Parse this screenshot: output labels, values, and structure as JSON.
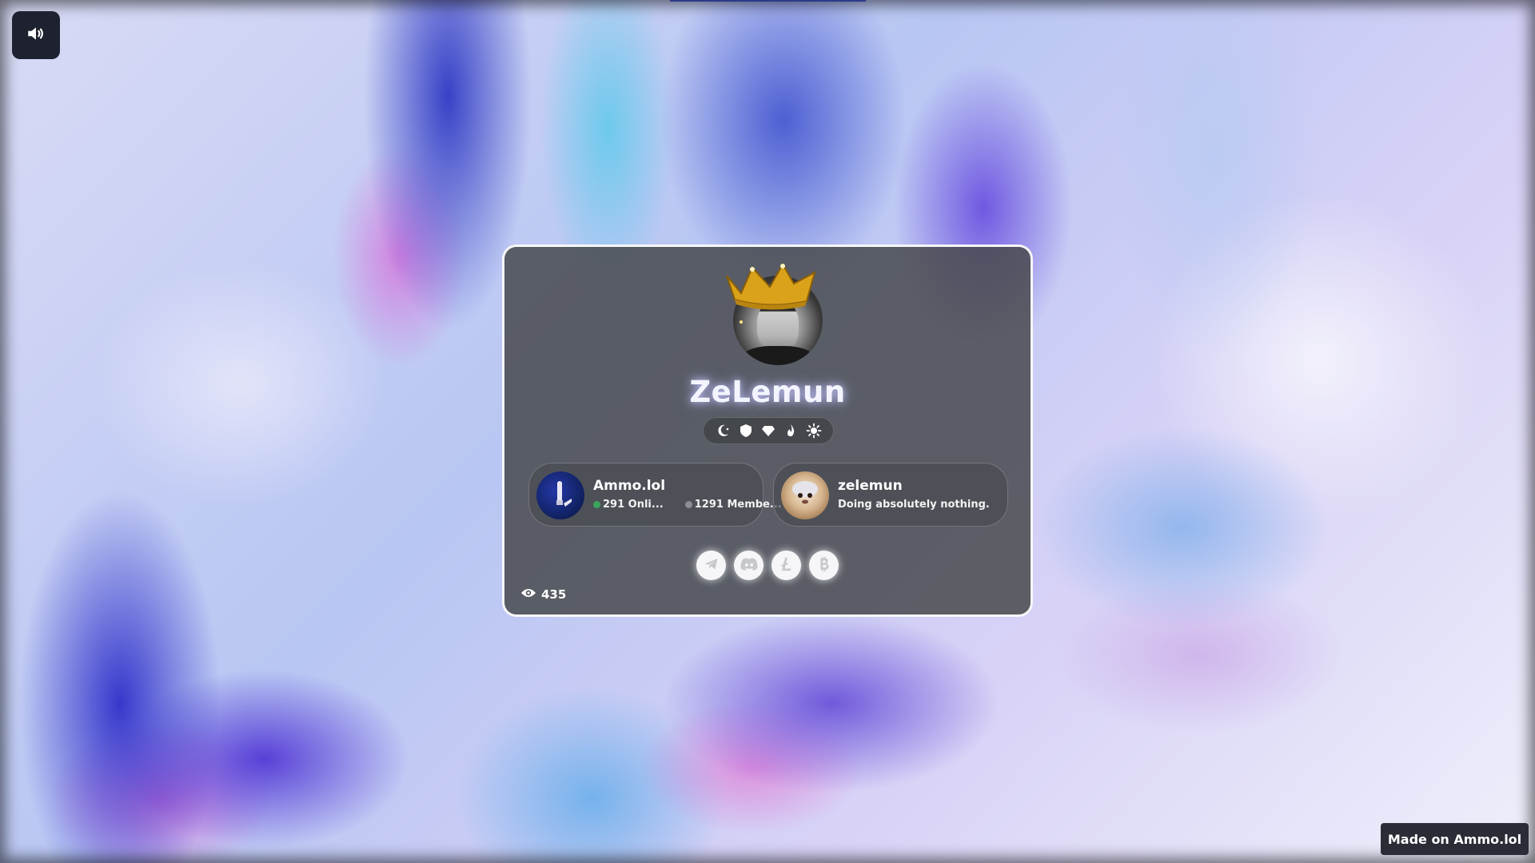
{
  "profile": {
    "username": "ZeLemun",
    "badges": [
      "moon-icon",
      "shield-icon",
      "gem-icon",
      "flame-icon",
      "sun-icon"
    ]
  },
  "widgets": {
    "server": {
      "name": "Ammo.lol",
      "online_text": "291 Onli...",
      "members_text": "1291 Membe...",
      "online_color": "#3ba55d",
      "members_color": "#8a8d93"
    },
    "user": {
      "name": "zelemun",
      "status": "Doing absolutely nothing."
    }
  },
  "socials": [
    "telegram-icon",
    "discord-icon",
    "litecoin-icon",
    "bitcoin-icon"
  ],
  "views": {
    "count": "435"
  },
  "footer": {
    "made_on": "Made on Ammo.lol"
  },
  "colors": {
    "card_bg": "#484a4e",
    "card_border": "#ffffff",
    "accent_glow": "#c8c8ff"
  }
}
